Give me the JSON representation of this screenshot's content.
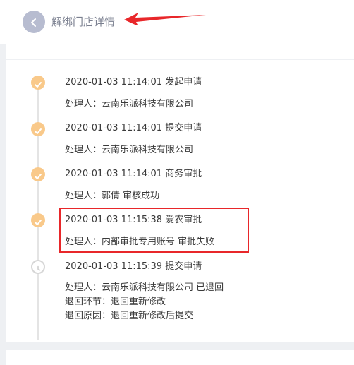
{
  "header": {
    "title": "解绑门店详情",
    "back_icon": "chevron-left-icon"
  },
  "colors": {
    "back_button": "#b7bcd0",
    "node_done": "#f9c98a",
    "timeline": "#e4e4e4",
    "annotation": "#e8272a"
  },
  "timeline": [
    {
      "status": "done",
      "icon": "check-icon",
      "title": "2020-01-03 11:14:01 发起申请",
      "details": [
        "处理人：云南乐派科技有限公司"
      ]
    },
    {
      "status": "done",
      "icon": "check-icon",
      "title": "2020-01-03 11:14:01 提交申请",
      "details": [
        "处理人：云南乐派科技有限公司"
      ]
    },
    {
      "status": "done",
      "icon": "check-icon",
      "title": "2020-01-03 11:14:01 商务审批",
      "details": [
        "处理人：郭倩 审核成功"
      ]
    },
    {
      "status": "done",
      "icon": "check-icon",
      "title": "2020-01-03 11:15:38 爱农审批",
      "details": [
        "处理人：内部审批专用账号 审批失败"
      ]
    },
    {
      "status": "pending",
      "icon": "clock-icon",
      "title": "2020-01-03 11:15:39 提交申请",
      "details": [
        "处理人：云南乐派科技有限公司 已退回",
        "退回环节：退回重新修改",
        "退回原因：退回重新修改后提交"
      ]
    }
  ]
}
